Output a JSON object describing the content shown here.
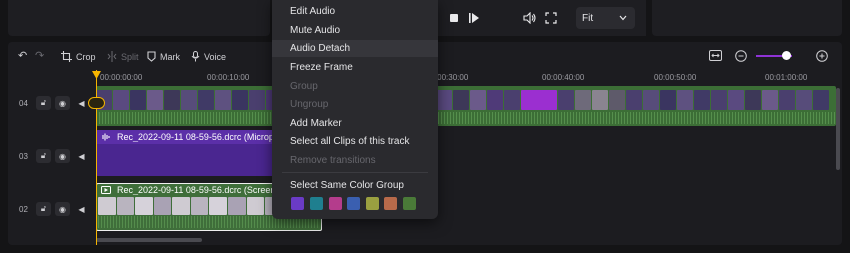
{
  "player": {
    "fit_label": "Fit",
    "chevron": "chevron-down-icon"
  },
  "toolbar": {
    "undo_icon": "↶",
    "redo_icon": "↷",
    "crop_label": "Crop",
    "split_label": "Split",
    "mark_label": "Mark",
    "voice_label": "Voice"
  },
  "ruler": {
    "ticks": [
      "00:00:00:00",
      "00:00:10:00",
      "00:00:30:00",
      "00:00:40:00",
      "00:00:50:00",
      "00:01:00:00"
    ]
  },
  "tracks": [
    {
      "number": "04"
    },
    {
      "number": "03",
      "clip_label": "Rec_2022-09-11 08-59-56.dcrc (Microp"
    },
    {
      "number": "02",
      "clip_label": "Rec_2022-09-11 08-59-56.dcrc (Screen"
    }
  ],
  "menu": {
    "items": [
      {
        "label": "Edit Audio",
        "enabled": true
      },
      {
        "label": "Mute Audio",
        "enabled": true
      },
      {
        "label": "Audio Detach",
        "enabled": true,
        "hover": true
      },
      {
        "label": "Freeze Frame",
        "enabled": true
      },
      {
        "label": "Group",
        "enabled": false
      },
      {
        "label": "Ungroup",
        "enabled": false
      },
      {
        "label": "Add Marker",
        "enabled": true
      },
      {
        "label": "Select all Clips of this track",
        "enabled": true
      },
      {
        "label": "Remove transitions",
        "enabled": false
      },
      {
        "label": "Select Same Color Group",
        "enabled": true
      }
    ],
    "swatches": [
      "#6a3bc6",
      "#1f7f8f",
      "#b43c8c",
      "#3a5fb0",
      "#9aa040",
      "#b86a4a",
      "#4a7a38"
    ]
  },
  "colors": {
    "accent_purple": "#8f33d6",
    "playhead": "#f5b400",
    "audio_clip": "#5b2fa8",
    "video_clip": "#3f6e3a"
  }
}
